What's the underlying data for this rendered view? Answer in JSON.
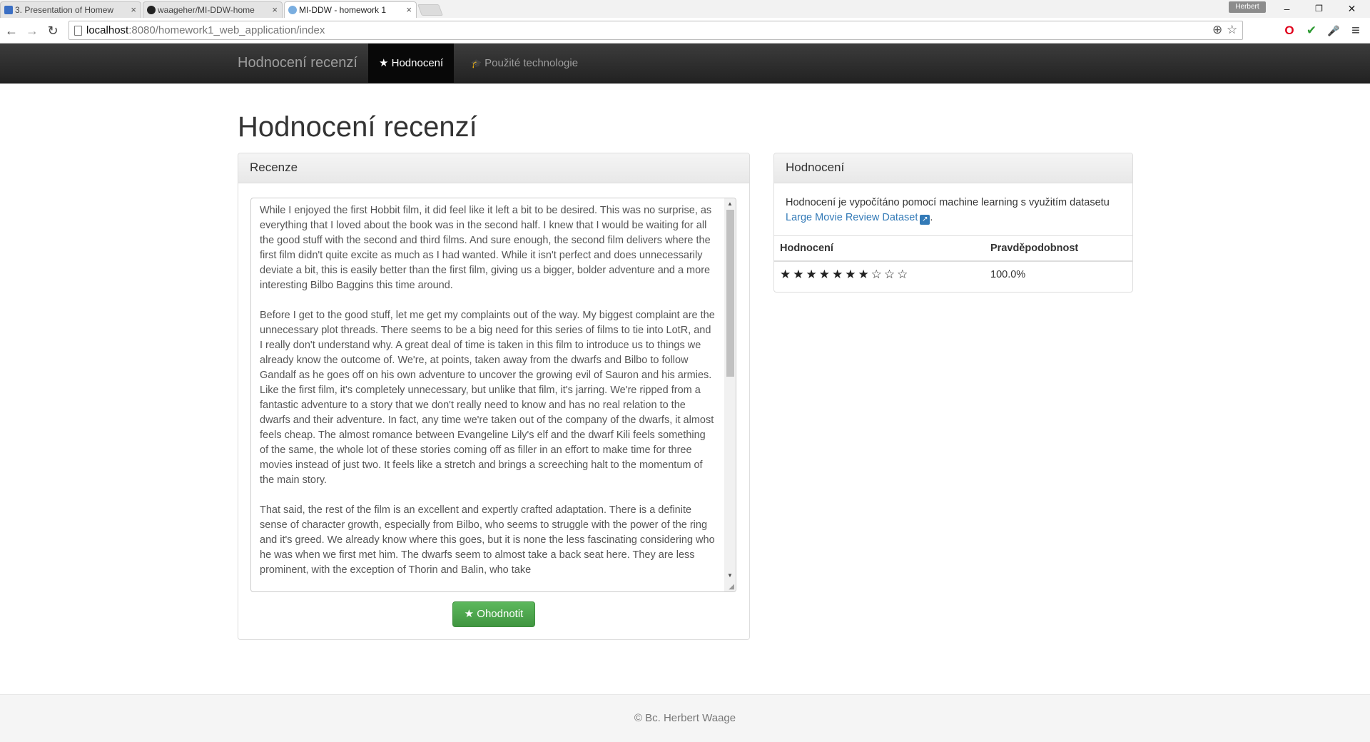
{
  "browser": {
    "tabs": [
      {
        "title": "3. Presentation of Homew",
        "favicon_color": "#3b6fc4"
      },
      {
        "title": "waageher/MI-DDW-home",
        "favicon_color": "#222222"
      },
      {
        "title": "MI-DDW - homework 1",
        "favicon_color": "#4a90d9"
      }
    ],
    "close_glyph": "×",
    "user_chip": "Herbert",
    "window_controls": {
      "minimize": "–",
      "restore": "❐",
      "close": "✕"
    },
    "url_host": "localhost",
    "url_rest": ":8080/homework1_web_application/index",
    "toolbar_icons": {
      "back": "←",
      "forward": "→",
      "reload": "↻",
      "zoom": "⊕",
      "star": "☆",
      "opera": "O",
      "ext": "✔",
      "mic": "🎤",
      "menu": "≡"
    }
  },
  "navbar": {
    "brand": "Hodnocení recenzí",
    "items": [
      {
        "icon": "★",
        "label": "Hodnocení"
      },
      {
        "icon": "🎓",
        "label": "Použité technologie"
      }
    ]
  },
  "page": {
    "title": "Hodnocení recenzí"
  },
  "review_panel": {
    "heading": "Recenze",
    "paragraphs": [
      "While I enjoyed the first Hobbit film, it did feel like it left a bit to be desired. This was no surprise, as everything that I loved about the book was in the second half. I knew that I would be waiting for all the good stuff with the second and third films. And sure enough, the second film delivers where the first film didn't quite excite as much as I had wanted. While it isn't perfect and does unnecessarily deviate a bit, this is easily better than the first film, giving us a bigger, bolder adventure and a more interesting Bilbo Baggins this time around.",
      "Before I get to the good stuff, let me get my complaints out of the way. My biggest complaint are the unnecessary plot threads. There seems to be a big need for this series of films to tie into LotR, and I really don't understand why. A great deal of time is taken in this film to introduce us to things we already know the outcome of. We're, at points, taken away from the dwarfs and Bilbo to follow Gandalf as he goes off on his own adventure to uncover the growing evil of Sauron and his armies. Like the first film, it's completely unnecessary, but unlike that film, it's jarring. We're ripped from a fantastic adventure to a story that we don't really need to know and has no real relation to the dwarfs and their adventure. In fact, any time we're taken out of the company of the dwarfs, it almost feels cheap. The almost romance between Evangeline Lily's elf and the dwarf Kili feels something of the same, the whole lot of these stories coming off as filler in an effort to make time for three movies instead of just two. It feels like a stretch and brings a screeching halt to the momentum of the main story.",
      "That said, the rest of the film is an excellent and expertly crafted adaptation. There is a definite sense of character growth, especially from Bilbo, who seems to struggle with the power of the ring and it's greed. We already know where this goes, but it is none the less fascinating considering who he was when we first met him. The dwarfs seem to almost take a back seat here. They are less prominent, with the exception of Thorin and Balin, who take"
    ],
    "submit_icon": "★",
    "submit_label": "Ohodnotit"
  },
  "rating_panel": {
    "heading": "Hodnocení",
    "description_prefix": "Hodnocení je vypočítáno pomocí machine learning s využitím datasetu ",
    "link_text": "Large Movie Review Dataset",
    "description_suffix": ".",
    "table_headers": [
      "Hodnocení",
      "Pravděpodobnost"
    ],
    "rows": [
      {
        "stars_filled": 7,
        "stars_total": 10,
        "stars": "★★★★★★★☆☆☆",
        "probability": "100.0%"
      }
    ]
  },
  "footer": {
    "text": "© Bc. Herbert Waage"
  }
}
